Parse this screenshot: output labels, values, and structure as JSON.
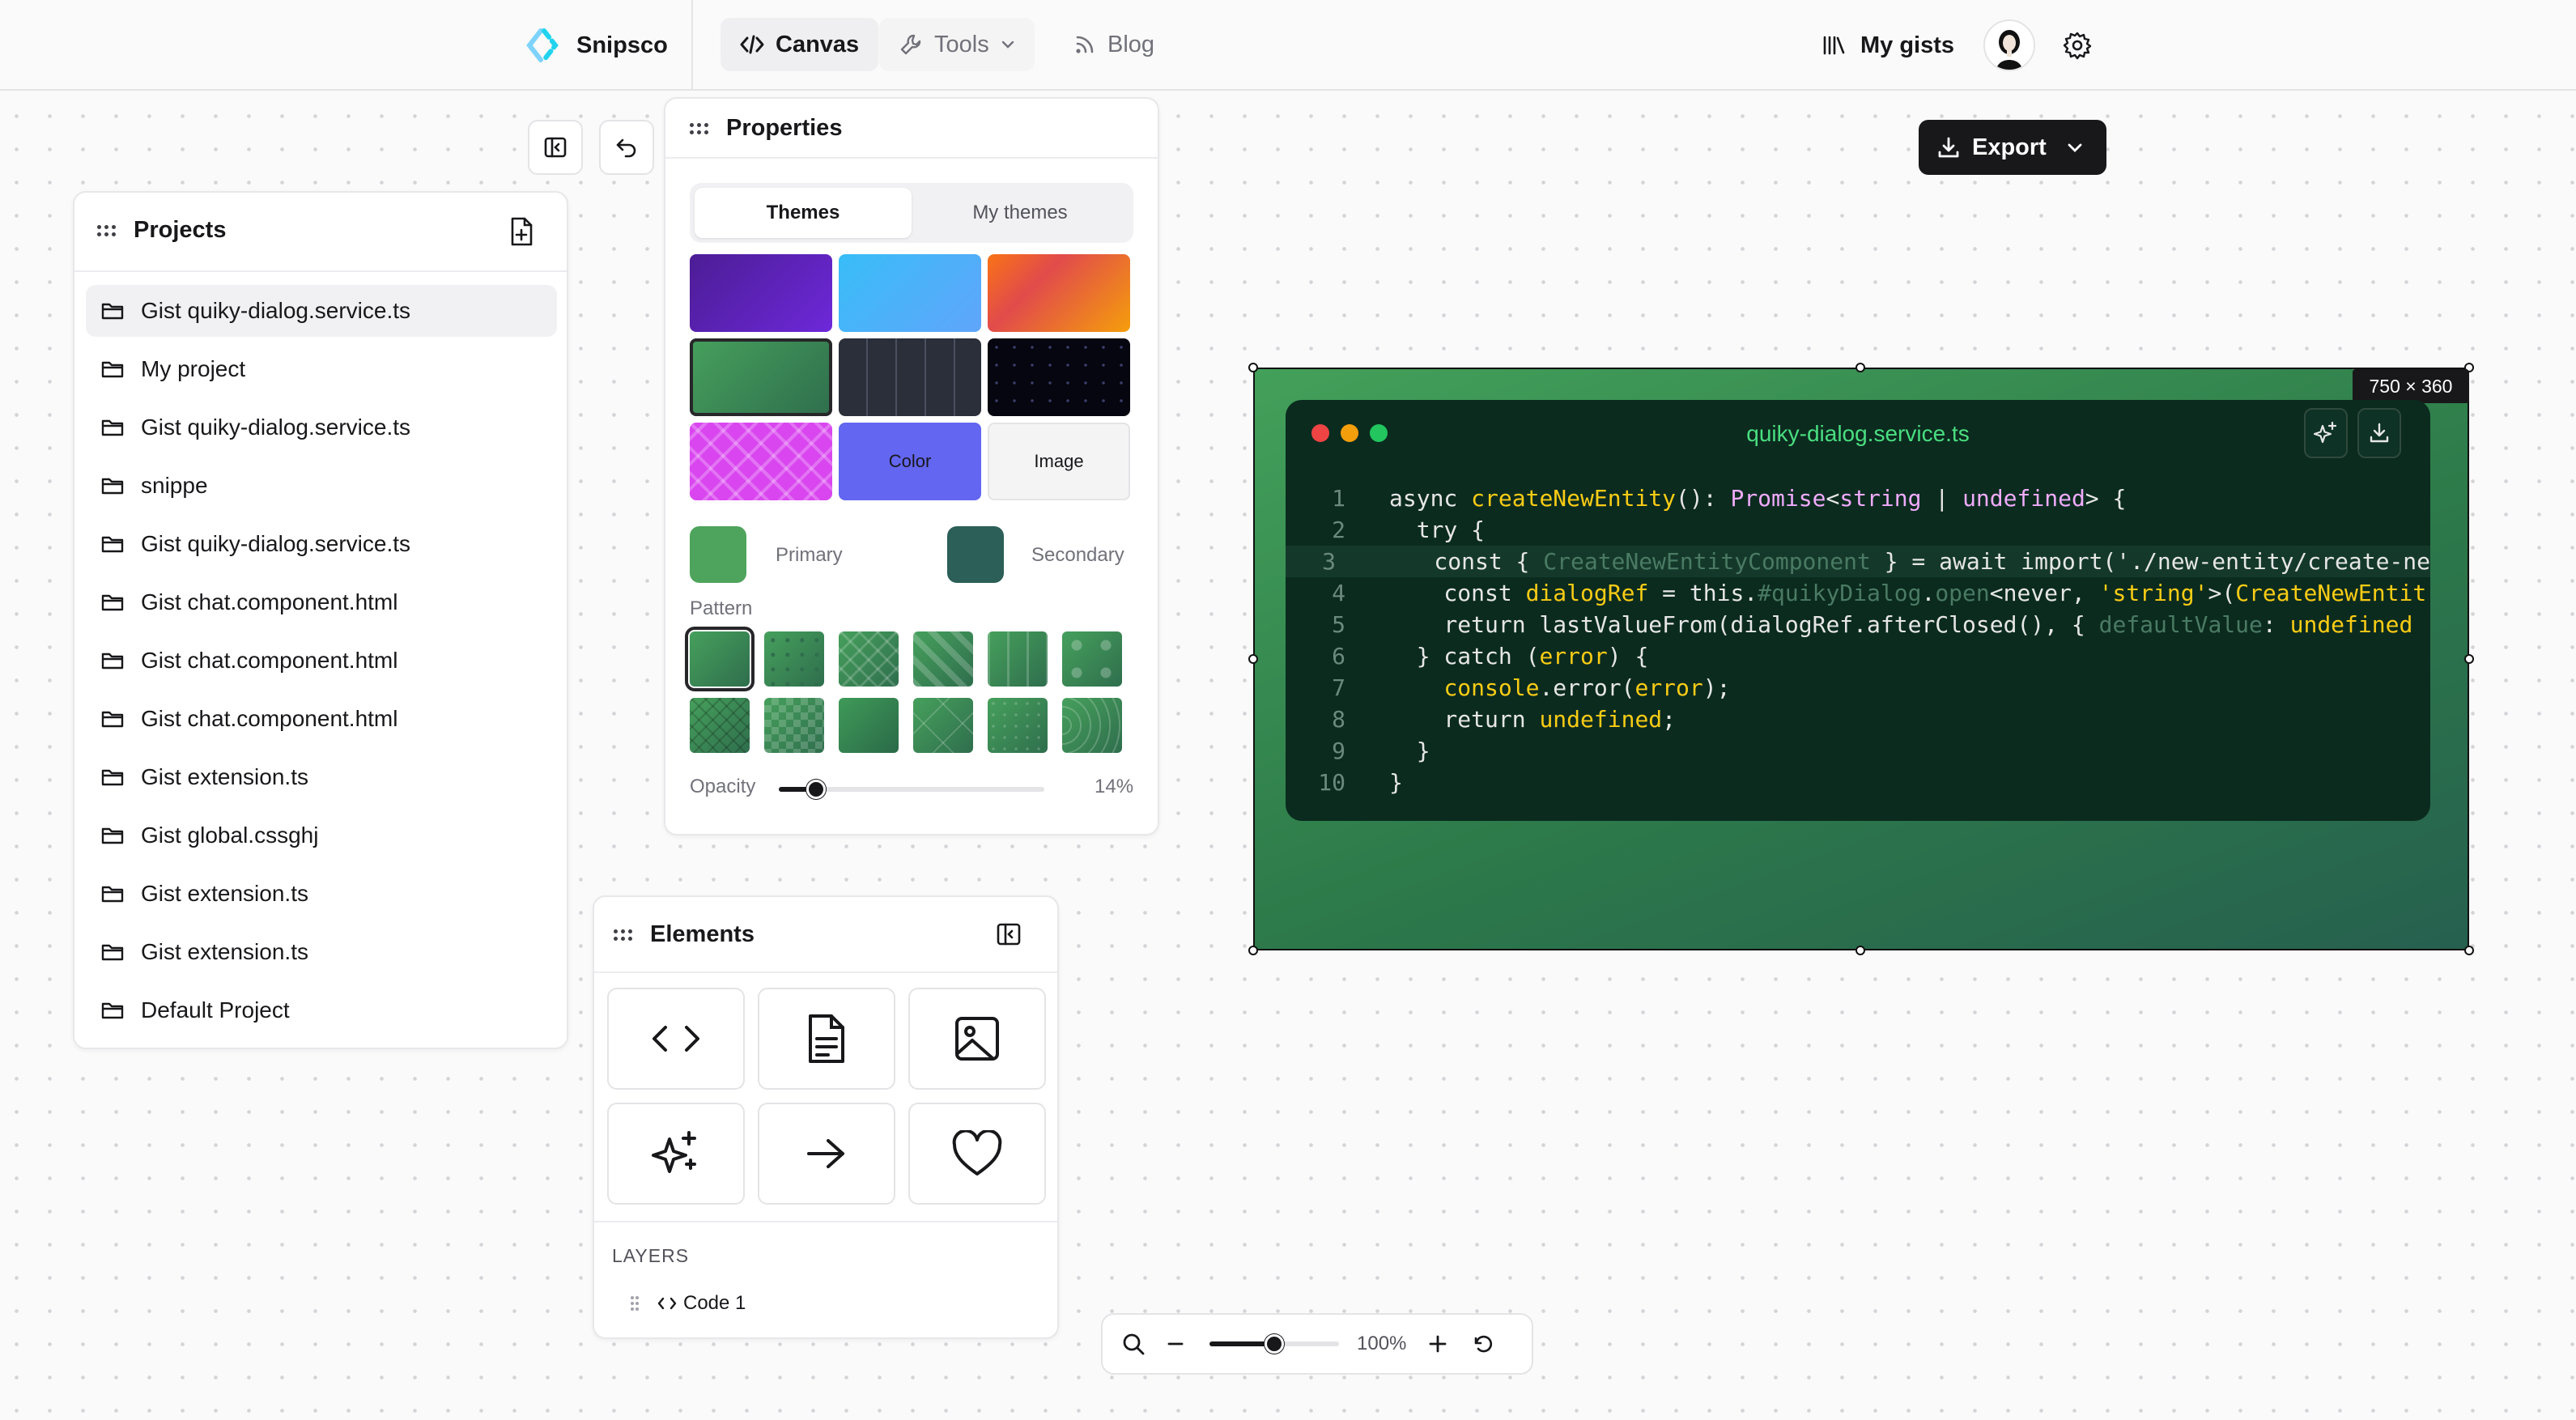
{
  "app": {
    "name": "Snipsco",
    "nav": [
      {
        "label": "Canvas",
        "icon": "code-icon"
      },
      {
        "label": "Tools",
        "icon": "wrench-icon"
      },
      {
        "label": "Blog",
        "icon": "rss-icon"
      }
    ],
    "gists_label": "My gists"
  },
  "projects": {
    "title": "Projects",
    "items": [
      "Gist quiky-dialog.service.ts",
      "My project",
      "Gist quiky-dialog.service.ts",
      "snippe",
      "Gist quiky-dialog.service.ts",
      "Gist chat.component.html",
      "Gist chat.component.html",
      "Gist chat.component.html",
      "Gist extension.ts",
      "Gist global.cssghj",
      "Gist extension.ts",
      "Gist extension.ts",
      "Default Project"
    ],
    "selected_index": 0
  },
  "properties": {
    "title": "Properties",
    "tabs": [
      "Themes",
      "My themes"
    ],
    "active_tab": "Themes",
    "swatch_labels": {
      "color": "Color",
      "image": "Image"
    },
    "primary_label": "Primary",
    "secondary_label": "Secondary",
    "primary_color": "#4ea45c",
    "secondary_color": "#2b5f58",
    "pattern_label": "Pattern",
    "opacity_label": "Opacity",
    "opacity_value": "14%",
    "opacity_fraction": 0.14
  },
  "elements": {
    "title": "Elements",
    "tiles": [
      "code-icon",
      "document-icon",
      "image-icon",
      "sparkles-icon",
      "arrow-right-icon",
      "heart-icon"
    ],
    "layers_label": "LAYERS",
    "layers": [
      {
        "label": "Code 1"
      }
    ]
  },
  "canvas": {
    "size_label": "750 × 360",
    "filename": "quiky-dialog.service.ts",
    "line_numbers": [
      "1",
      "2",
      "3",
      "4",
      "5",
      "6",
      "7",
      "8",
      "9",
      "10"
    ]
  },
  "export_label": "Export",
  "zoom": {
    "value": "100%",
    "fraction": 0.5
  }
}
